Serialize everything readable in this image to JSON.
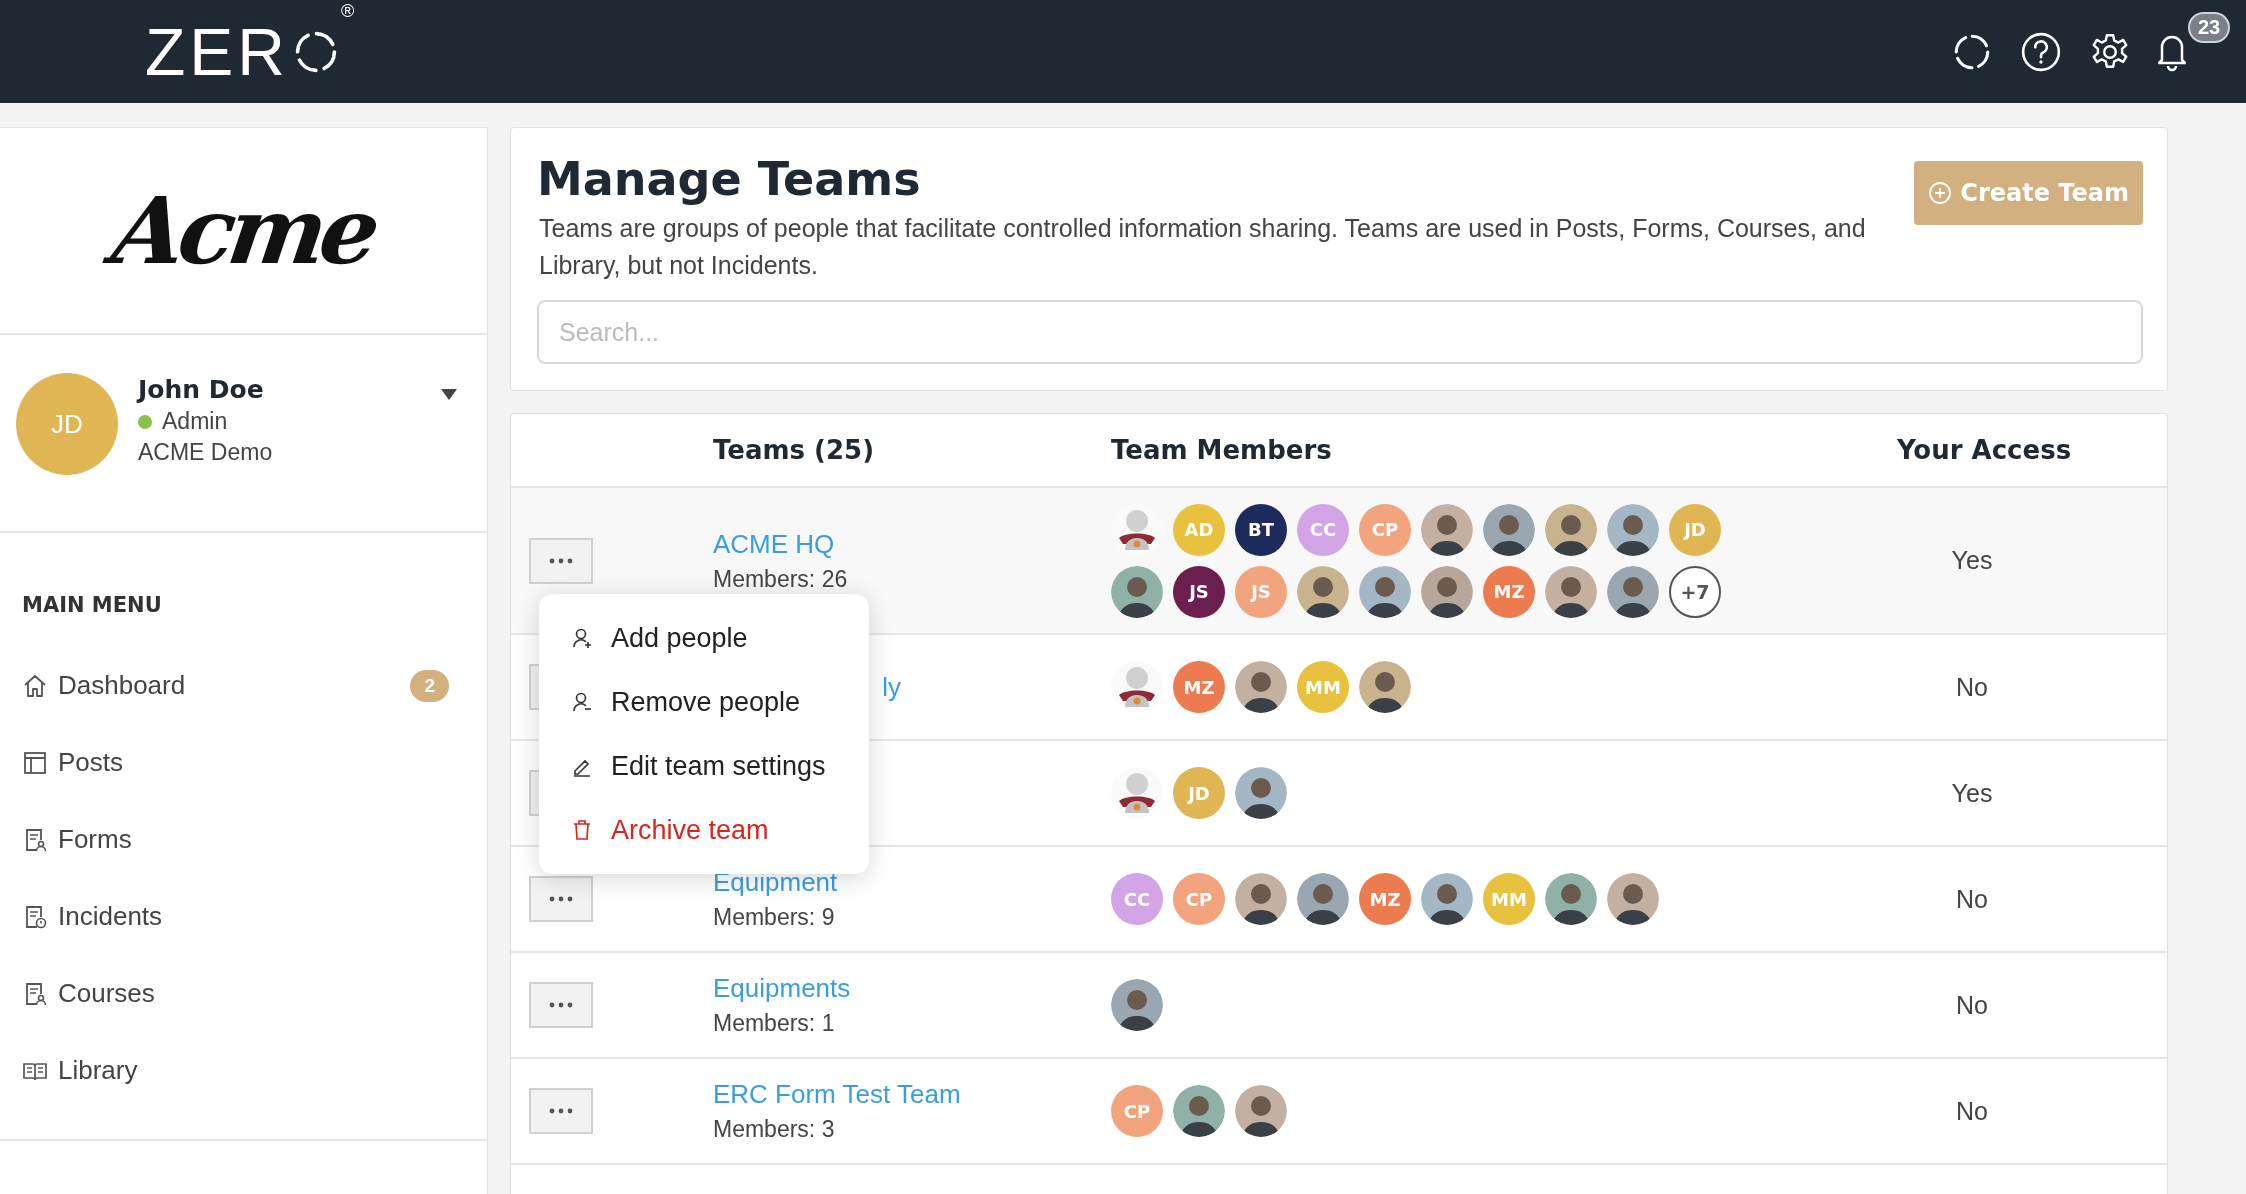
{
  "header": {
    "logo": {
      "text": "ZER",
      "mark": "®"
    },
    "notifications": "23"
  },
  "sidebar": {
    "logo": "Acme",
    "user": {
      "initials": "JD",
      "name": "John Doe",
      "role": "Admin",
      "online": true,
      "org": "ACME Demo"
    },
    "menu_title": "MAIN MENU",
    "items": [
      {
        "kind": "home",
        "label": "Dashboard",
        "badge": "2"
      },
      {
        "kind": "posts",
        "label": "Posts"
      },
      {
        "kind": "forms",
        "label": "Forms"
      },
      {
        "kind": "incidents",
        "label": "Incidents"
      },
      {
        "kind": "courses",
        "label": "Courses"
      },
      {
        "kind": "library",
        "label": "Library"
      }
    ]
  },
  "page": {
    "title": "Manage Teams",
    "description": "Teams are groups of people that facilitate controlled information sharing. Teams are used in Posts, Forms, Courses, and Library, but not Incidents.",
    "create_button": "Create Team",
    "search": {
      "placeholder": "Search..."
    }
  },
  "table": {
    "columns": [
      "Teams (25)",
      "Team Members",
      "Your Access"
    ],
    "rows": [
      {
        "name": "ACME HQ",
        "members_count": "Members: 26",
        "access": "Yes",
        "selected": true,
        "covered": false,
        "members": [
          {
            "kind": "default"
          },
          {
            "kind": "initials",
            "text": "AD",
            "color": "#e8c23e"
          },
          {
            "kind": "initials",
            "text": "BT",
            "color": "#1d2a5c"
          },
          {
            "kind": "initials",
            "text": "CC",
            "color": "#d3a5e6"
          },
          {
            "kind": "initials",
            "text": "CP",
            "color": "#f1a47e"
          },
          {
            "kind": "photo"
          },
          {
            "kind": "photo"
          },
          {
            "kind": "photo"
          },
          {
            "kind": "photo"
          },
          {
            "kind": "initials",
            "text": "JD",
            "color": "#e0b655"
          },
          {
            "kind": "photo"
          },
          {
            "kind": "initials",
            "text": "JS",
            "color": "#6a1f4f"
          },
          {
            "kind": "initials",
            "text": "JS",
            "color": "#f1a47e"
          },
          {
            "kind": "photo"
          },
          {
            "kind": "photo"
          },
          {
            "kind": "photo"
          },
          {
            "kind": "initials",
            "text": "MZ",
            "color": "#ec7c50"
          },
          {
            "kind": "photo"
          },
          {
            "kind": "photo"
          },
          {
            "kind": "more",
            "text": "+7"
          }
        ]
      },
      {
        "name": "ly",
        "covered": true,
        "access": "No",
        "selected": false,
        "members": [
          {
            "kind": "default"
          },
          {
            "kind": "initials",
            "text": "MZ",
            "color": "#ec7c50"
          },
          {
            "kind": "photo"
          },
          {
            "kind": "initials",
            "text": "MM",
            "color": "#e8c23e"
          },
          {
            "kind": "photo"
          }
        ]
      },
      {
        "access": "Yes",
        "selected": false,
        "members": [
          {
            "kind": "default"
          },
          {
            "kind": "initials",
            "text": "JD",
            "color": "#e0b655"
          },
          {
            "kind": "photo"
          }
        ]
      },
      {
        "name": "Equipment",
        "members_count": "Members: 9",
        "access": "No",
        "selected": false,
        "covered": false,
        "members": [
          {
            "kind": "initials",
            "text": "CC",
            "color": "#d3a5e6"
          },
          {
            "kind": "initials",
            "text": "CP",
            "color": "#f1a47e"
          },
          {
            "kind": "photo"
          },
          {
            "kind": "photo"
          },
          {
            "kind": "initials",
            "text": "MZ",
            "color": "#ec7c50"
          },
          {
            "kind": "photo"
          },
          {
            "kind": "initials",
            "text": "MM",
            "color": "#e8c23e"
          },
          {
            "kind": "photo"
          },
          {
            "kind": "photo"
          }
        ]
      },
      {
        "name": "Equipments",
        "members_count": "Members: 1",
        "access": "No",
        "selected": false,
        "covered": false,
        "members": [
          {
            "kind": "photo"
          }
        ]
      },
      {
        "name": "ERC Form Test Team",
        "members_count": "Members: 3",
        "access": "No",
        "selected": false,
        "covered": false,
        "members": [
          {
            "kind": "initials",
            "text": "CP",
            "color": "#f1a47e"
          },
          {
            "kind": "photo"
          },
          {
            "kind": "photo"
          }
        ]
      }
    ],
    "row_menu": {
      "items": [
        {
          "kind": "add",
          "label": "Add people"
        },
        {
          "kind": "remove",
          "label": "Remove people"
        },
        {
          "kind": "edit",
          "label": "Edit team settings"
        },
        {
          "kind": "archive",
          "label": "Archive team"
        }
      ]
    }
  }
}
